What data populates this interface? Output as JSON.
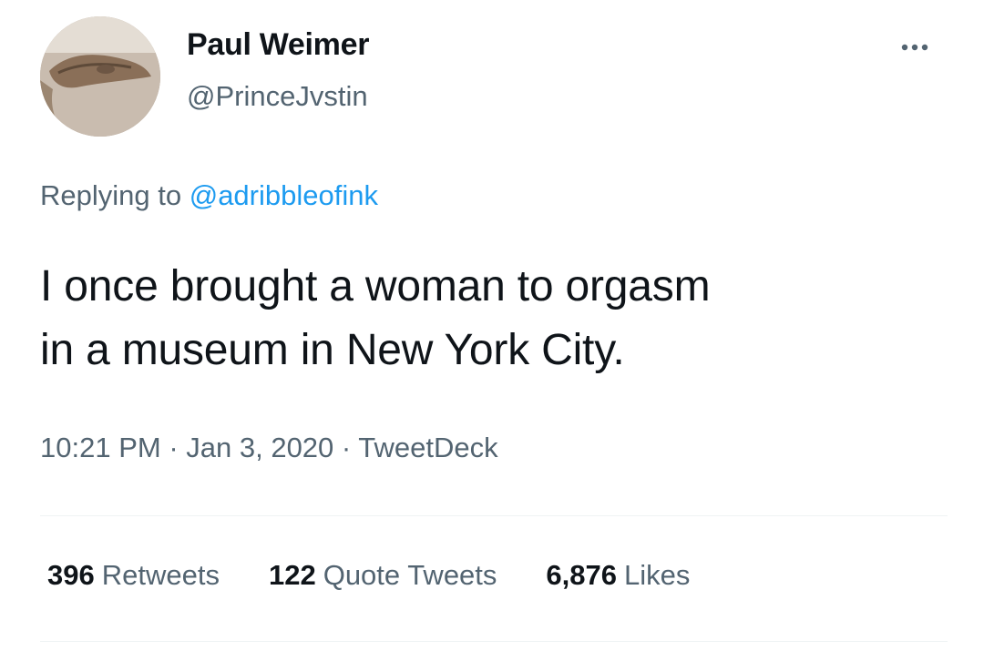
{
  "author": {
    "name": "Paul Weimer",
    "handle": "@PrinceJvstin"
  },
  "reply": {
    "prefix": "Replying to ",
    "mention": "@adribbleofink"
  },
  "tweet": {
    "line1": "I once brought a woman to orgasm",
    "line2": "in a museum in New York City."
  },
  "meta": {
    "time": "10:21 PM",
    "date": "Jan 3, 2020",
    "separator": " · ",
    "source": "TweetDeck"
  },
  "stats": {
    "retweets_count": "396",
    "retweets_label": "Retweets",
    "quotes_count": "122",
    "quotes_label": "Quote Tweets",
    "likes_count": "6,876",
    "likes_label": "Likes"
  },
  "icons": {
    "more": "more-horizontal-icon"
  },
  "colors": {
    "text": "#0f1419",
    "secondary": "#536471",
    "link": "#1d9bf0",
    "divider": "#eff3f4"
  }
}
